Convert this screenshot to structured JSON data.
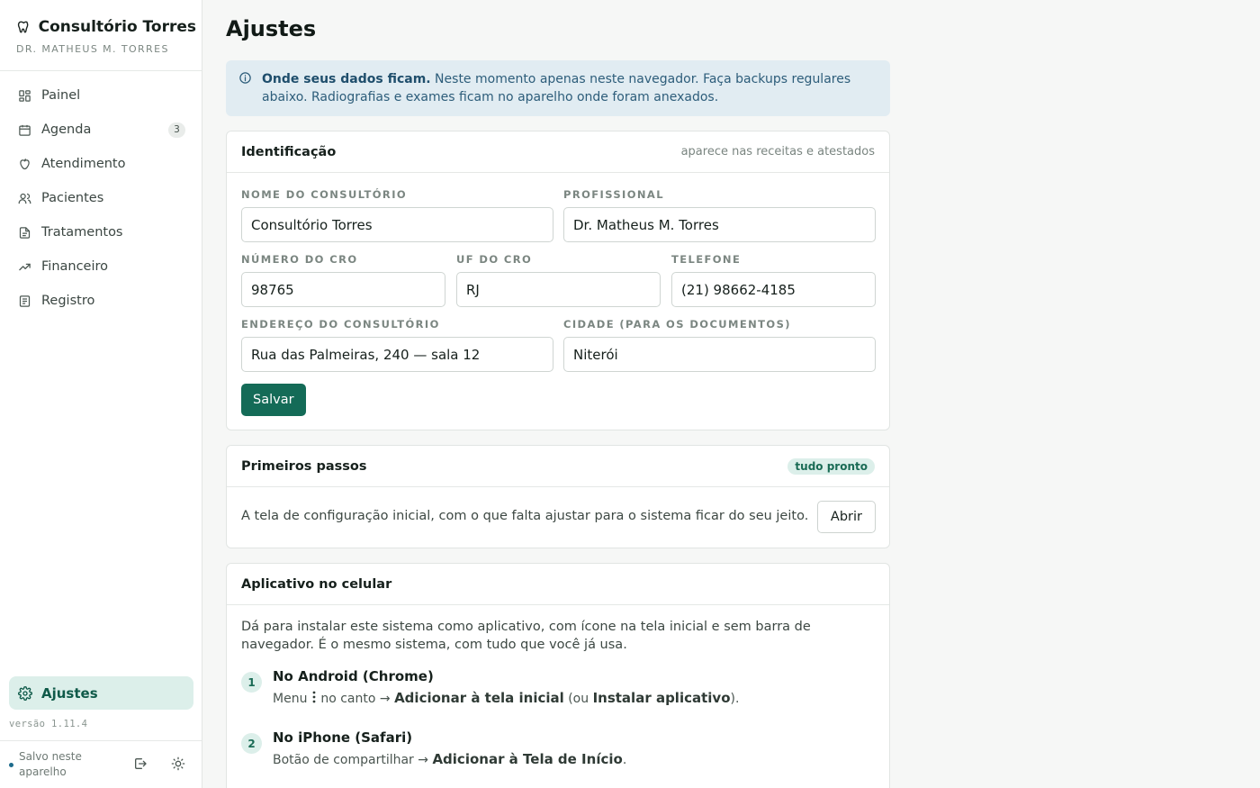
{
  "sidebar": {
    "brand_title": "Consultório Torres",
    "brand_subtitle": "DR. MATHEUS M. TORRES",
    "items": [
      {
        "label": "Painel",
        "icon": "grid-icon"
      },
      {
        "label": "Agenda",
        "icon": "calendar-icon",
        "badge": "3"
      },
      {
        "label": "Atendimento",
        "icon": "tooth-icon"
      },
      {
        "label": "Pacientes",
        "icon": "users-icon"
      },
      {
        "label": "Tratamentos",
        "icon": "document-icon"
      },
      {
        "label": "Financeiro",
        "icon": "trend-up-icon"
      },
      {
        "label": "Registro",
        "icon": "list-icon"
      }
    ],
    "active_item": "Ajustes",
    "version": "versão 1.11.4",
    "saved_status": "Salvo neste aparelho"
  },
  "page": {
    "title": "Ajustes"
  },
  "info": {
    "bold": "Onde seus dados ficam.",
    "text": " Neste momento apenas neste navegador. Faça backups regulares abaixo. Radiografias e exames ficam no aparelho onde foram anexados."
  },
  "identificacao": {
    "title": "Identificação",
    "hint": "aparece nas receitas e atestados",
    "fields": {
      "nome": {
        "label": "Nome do consultório",
        "value": "Consultório Torres"
      },
      "profissional": {
        "label": "Profissional",
        "value": "Dr. Matheus M. Torres"
      },
      "cro": {
        "label": "Número do CRO",
        "value": "98765"
      },
      "uf": {
        "label": "UF do CRO",
        "value": "RJ"
      },
      "telefone": {
        "label": "Telefone",
        "value": "(21) 98662-4185"
      },
      "endereco": {
        "label": "Endereço do consultório",
        "value": "Rua das Palmeiras, 240 — sala 12"
      },
      "cidade": {
        "label": "Cidade (para os documentos)",
        "value": "Niterói"
      }
    },
    "save_label": "Salvar"
  },
  "primeiros_passos": {
    "title": "Primeiros passos",
    "badge": "tudo pronto",
    "text": "A tela de configuração inicial, com o que falta ajustar para o sistema ficar do seu jeito.",
    "button": "Abrir"
  },
  "aplicativo": {
    "title": "Aplicativo no celular",
    "description": "Dá para instalar este sistema como aplicativo, com ícone na tela inicial e sem barra de navegador. É o mesmo sistema, com tudo que você já usa.",
    "steps": [
      {
        "num": "1",
        "title": "No Android (Chrome)",
        "p1": "Menu ",
        "p2": " no canto → ",
        "b1": "Adicionar à tela inicial",
        "p3": " (ou ",
        "b2": "Instalar aplicativo",
        "p4": ")."
      },
      {
        "num": "2",
        "title": "No iPhone (Safari)",
        "p1": "Botão de compartilhar → ",
        "b1": "Adicionar à Tela de Início",
        "p2": "."
      }
    ]
  }
}
